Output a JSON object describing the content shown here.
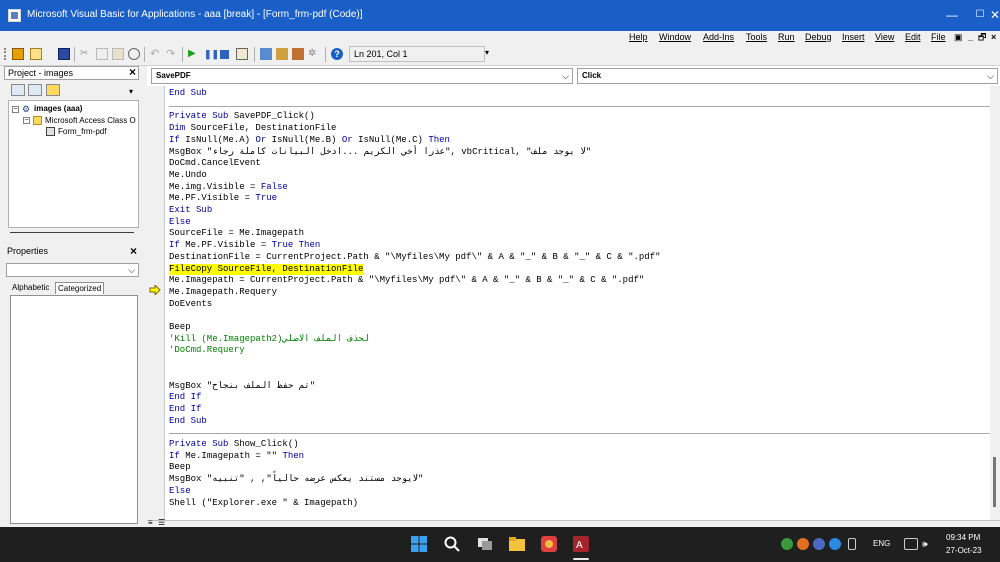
{
  "titlebar": {
    "title": "Microsoft Visual Basic for Applications - aaa [break] - [Form_frm-pdf (Code)]",
    "minimize": "—",
    "maximize": "☐",
    "close": "✕"
  },
  "menubar": {
    "items": [
      "Help",
      "Window",
      "Add-Ins",
      "Tools",
      "Run",
      "Debug",
      "Insert",
      "View",
      "Edit",
      "File"
    ],
    "child_min": "_",
    "child_restore": "🗗",
    "child_close": "×"
  },
  "toolbar": {
    "status": "Ln 201, Col 1",
    "help": "?"
  },
  "project_panel": {
    "title": "Project - images",
    "close": "×",
    "tree": {
      "root": "images (aaa)",
      "folder": "Microsoft Access Class O",
      "form": "Form_frm-pdf"
    }
  },
  "properties_panel": {
    "title": "Properties",
    "close": "×",
    "tabs": [
      "Alphabetic",
      "Categorized"
    ]
  },
  "code_window": {
    "object_combo": "SavePDF",
    "procedure_combo": "Click",
    "lines": [
      "End Sub",
      "",
      "Private Sub SavePDF_Click()",
      "Dim SourceFile, DestinationFile",
      "If IsNull(Me.A) Or IsNull(Me.B) Or IsNull(Me.C) Then",
      "MsgBox \"عذرا أخي الكريم ...ادخل البيانات كاملة رجاء\", vbCritical, \"لا يوجد ملف\"",
      "DoCmd.CancelEvent",
      "Me.Undo",
      "Me.img.Visible = False",
      "Me.PF.Visible = True",
      "Exit Sub",
      "Else",
      "SourceFile = Me.Imagepath",
      "If Me.PF.Visible = True Then",
      "DestinationFile = CurrentProject.Path & \"\\Myfiles\\My pdf\\\" & A & \"_\" & B & \"_\" & C & \".pdf\"",
      "FileCopy SourceFile, DestinationFile",
      "Me.Imagepath = CurrentProject.Path & \"\\Myfiles\\My pdf\\\" & A & \"_\" & B & \"_\" & C & \".pdf\"",
      "Me.Imagepath.Requery",
      "DoEvents",
      "",
      "Beep",
      "'Kill (Me.Imagepath2)لحذف الملف الاصلي",
      "'DoCmd.Requery",
      "",
      "",
      "MsgBox \"تم حفظ الملف بنجاح\"",
      "End If",
      "End If",
      "End Sub",
      "",
      "Private Sub Show_Click()",
      "If Me.Imagepath = \"\" Then",
      "Beep",
      "MsgBox \"لايوجد مستند يعكس عرضه حالياً\", , \"تنبيه\"",
      "Else",
      "Shell (\"Explorer.exe \" & Imagepath)"
    ]
  },
  "taskbar": {
    "lang": "ENG",
    "time": "09:34 PM",
    "date": "27-Oct-23"
  },
  "colors": {
    "titlebar": "#1a5fc7",
    "keyword": "#0000a0",
    "comment": "#008000",
    "highlight": "#ffff00",
    "taskbar": "#1f1f1f"
  }
}
